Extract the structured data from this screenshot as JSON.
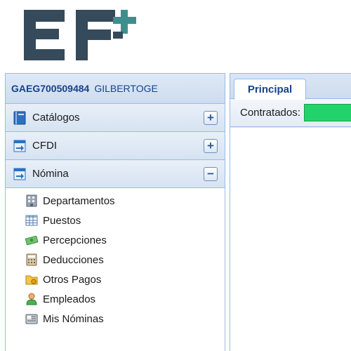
{
  "logo": {
    "text": "EF+"
  },
  "user": {
    "rfc": "GAEG700509484",
    "name": "GILBERTOGE"
  },
  "menu": {
    "sections": [
      {
        "label": "Catálogos",
        "toggle": "+",
        "icon": "book-icon"
      },
      {
        "label": "CFDI",
        "toggle": "+",
        "icon": "document-arrow-icon"
      },
      {
        "label": "Nómina",
        "toggle": "−",
        "icon": "document-arrow-icon"
      }
    ],
    "nomina_items": [
      {
        "label": "Departamentos",
        "icon": "building-icon"
      },
      {
        "label": "Puestos",
        "icon": "table-grid-icon"
      },
      {
        "label": "Percepciones",
        "icon": "money-icon"
      },
      {
        "label": "Deducciones",
        "icon": "calculator-icon"
      },
      {
        "label": "Otros Pagos",
        "icon": "folder-coins-icon"
      },
      {
        "label": "Empleados",
        "icon": "person-icon"
      },
      {
        "label": "Mis Nóminas",
        "icon": "payroll-list-icon"
      }
    ]
  },
  "tabs": [
    {
      "label": "Principal"
    }
  ],
  "toolbar": {
    "contratados_label": "Contratados:"
  },
  "colors": {
    "accent": "#15428b",
    "panel_border": "#99bbe8",
    "status_green": "#22d36c"
  }
}
